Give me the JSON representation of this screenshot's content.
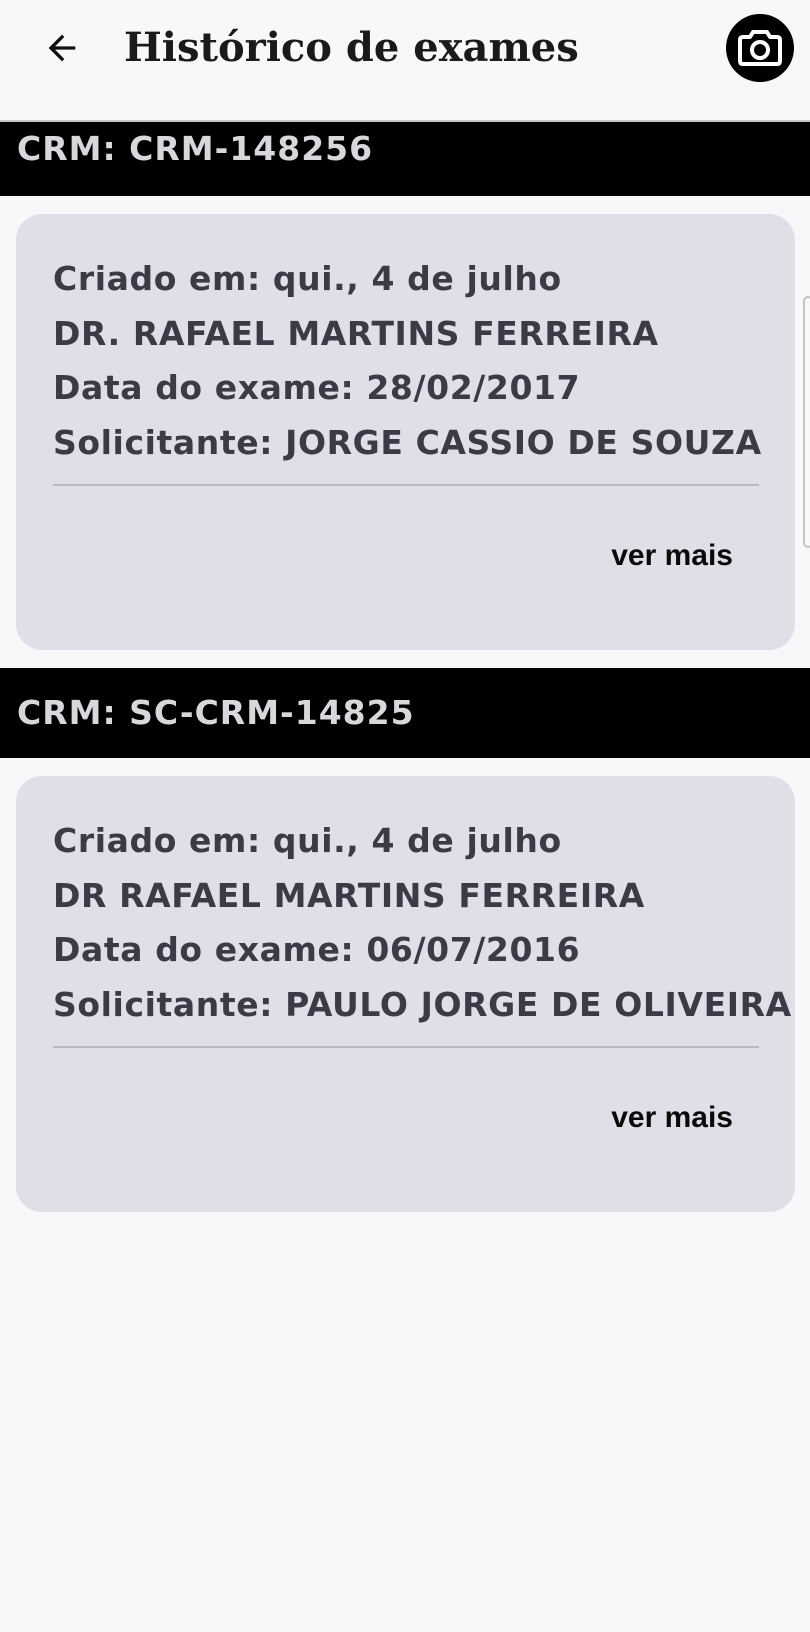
{
  "header": {
    "title": "Histórico de exames",
    "back_icon": "arrow-left-icon",
    "camera_icon": "camera-icon"
  },
  "groups": [
    {
      "crm_label": "CRM: CRM-148256",
      "card": {
        "created": "Criado em: qui., 4 de julho",
        "doctor": "DR. RAFAEL MARTINS FERREIRA",
        "exam_date": "Data do exame: 28/02/2017",
        "requester": "Solicitante: JORGE CASSIO DE SOUZA",
        "more_label": "ver mais"
      }
    },
    {
      "crm_label": "CRM: SC-CRM-14825",
      "card": {
        "created": "Criado em: qui., 4 de julho",
        "doctor": "DR RAFAEL MARTINS FERREIRA",
        "exam_date": "Data do exame: 06/07/2016",
        "requester": "Solicitante: PAULO JORGE DE OLIVEIRA",
        "more_label": "ver mais"
      }
    }
  ],
  "colors": {
    "background": "#f8f8fa",
    "card": "#dfdfe7",
    "crm_bar": "#000000",
    "card_text": "#3b3b48"
  }
}
